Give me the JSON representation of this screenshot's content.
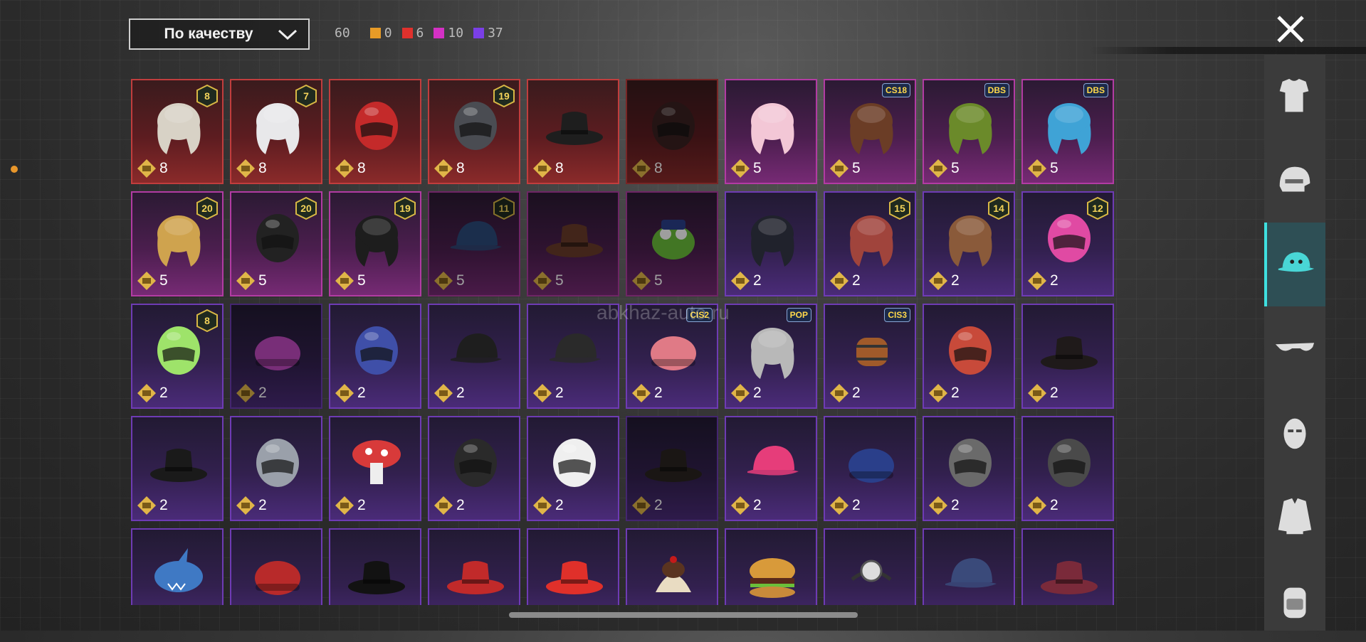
{
  "sort": {
    "label": "По качеству"
  },
  "counts": {
    "total": "60",
    "tiers": [
      {
        "color": "#e79b27",
        "count": "0"
      },
      {
        "color": "#e0312d",
        "count": "6"
      },
      {
        "color": "#d431c4",
        "count": "10"
      },
      {
        "color": "#7a3fe6",
        "count": "37"
      }
    ]
  },
  "watermark": "abkhaz-auto.ru",
  "items": [
    {
      "name": "white-hair-helmet",
      "quality": "red",
      "value": "8",
      "level": "8",
      "icon": "hair-white",
      "color": "#d8d2c6"
    },
    {
      "name": "white-long-hair",
      "quality": "red",
      "value": "8",
      "level": "7",
      "icon": "hair-long-white",
      "color": "#e8e8ea"
    },
    {
      "name": "red-helmet",
      "quality": "red",
      "value": "8",
      "icon": "helmet-red",
      "color": "#c42a2a"
    },
    {
      "name": "dark-visor-helmet",
      "quality": "red",
      "value": "8",
      "level": "19",
      "icon": "helmet-dark",
      "color": "#4a4c52"
    },
    {
      "name": "tricorn-hat",
      "quality": "red",
      "value": "8",
      "icon": "tricorn",
      "color": "#1e1e1e"
    },
    {
      "name": "orange-black-helmet",
      "quality": "red",
      "value": "8",
      "dim": true,
      "icon": "helmet-orange",
      "color": "#3a2020"
    },
    {
      "name": "pink-pigtails",
      "quality": "pink",
      "value": "5",
      "icon": "hair-pink",
      "color": "#f3c7d6"
    },
    {
      "name": "brown-short-hair",
      "quality": "pink",
      "value": "5",
      "tag": "CS18",
      "icon": "hair-brown",
      "color": "#6b3d26"
    },
    {
      "name": "dragon-ball-cap-hair",
      "quality": "pink",
      "value": "5",
      "tag": "DBS",
      "icon": "hair-green-cap",
      "color": "#6b8a2a"
    },
    {
      "name": "blue-spiky-hair",
      "quality": "pink",
      "value": "5",
      "tag": "DBS",
      "icon": "hair-blue",
      "color": "#3fa3d6"
    },
    {
      "name": "blonde-witch-hat",
      "quality": "pink",
      "value": "5",
      "level": "20",
      "icon": "hair-blonde",
      "color": "#cfa34e"
    },
    {
      "name": "gold-black-helmet",
      "quality": "pink",
      "value": "5",
      "level": "20",
      "icon": "helmet-gold",
      "color": "#222"
    },
    {
      "name": "black-bun-hair",
      "quality": "pink",
      "value": "5",
      "level": "19",
      "icon": "hair-black",
      "color": "#1d1d1d"
    },
    {
      "name": "blue-cap-hair",
      "quality": "pink",
      "value": "5",
      "level": "11",
      "dim": true,
      "icon": "cap-blue",
      "color": "#2b4a7a"
    },
    {
      "name": "cowboy-frog-hat",
      "quality": "pink",
      "value": "5",
      "dim": true,
      "icon": "cowboy",
      "color": "#6b3c2a"
    },
    {
      "name": "frog-police-hat",
      "quality": "pink",
      "value": "5",
      "dim": true,
      "icon": "frog",
      "color": "#6bbf3a"
    },
    {
      "name": "black-long-hair",
      "quality": "purple",
      "value": "2",
      "icon": "hair-black-long",
      "color": "#20222c"
    },
    {
      "name": "red-hair-pumpkin",
      "quality": "purple",
      "value": "2",
      "level": "15",
      "icon": "hair-red",
      "color": "#a0443c"
    },
    {
      "name": "cat-ear-hair",
      "quality": "purple",
      "value": "2",
      "level": "14",
      "icon": "hair-cat",
      "color": "#8a5a3a"
    },
    {
      "name": "bunny-ear-helmet",
      "quality": "purple",
      "value": "2",
      "level": "12",
      "icon": "helmet-bunny",
      "color": "#e04aa3"
    },
    {
      "name": "green-skull-hair",
      "quality": "purple",
      "value": "2",
      "level": "8",
      "icon": "skull-green",
      "color": "#9ee36a"
    },
    {
      "name": "pink-beanie",
      "quality": "purple",
      "value": "2",
      "dim": true,
      "icon": "beanie-pink",
      "color": "#c24ac2"
    },
    {
      "name": "robot-helmet",
      "quality": "purple",
      "value": "2",
      "icon": "helmet-robot",
      "color": "#3f4fa8"
    },
    {
      "name": "black-cap",
      "quality": "purple",
      "value": "2",
      "icon": "cap-black",
      "color": "#1e1e1e"
    },
    {
      "name": "mesh-cap",
      "quality": "purple",
      "value": "2",
      "icon": "cap-mesh",
      "color": "#2a2a2a"
    },
    {
      "name": "striped-beanie",
      "quality": "purple",
      "value": "2",
      "tag": "CIS2",
      "icon": "beanie-stripe",
      "color": "#e07a86"
    },
    {
      "name": "silver-short-hair",
      "quality": "purple",
      "value": "2",
      "tag": "POP",
      "icon": "hair-silver",
      "color": "#b8b8b8"
    },
    {
      "name": "barrel-hat",
      "quality": "purple",
      "value": "2",
      "tag": "CIS3",
      "icon": "barrel",
      "color": "#a05a2a"
    },
    {
      "name": "football-helmet",
      "quality": "purple",
      "value": "2",
      "icon": "helmet-football",
      "color": "#c84a3a"
    },
    {
      "name": "sombrero",
      "quality": "purple",
      "value": "2",
      "icon": "sombrero",
      "color": "#1f1a1a"
    },
    {
      "name": "pork-pie-hat",
      "quality": "purple",
      "value": "2",
      "icon": "hat-pork",
      "color": "#1a1a1a"
    },
    {
      "name": "goggles-helmet",
      "quality": "purple",
      "value": "2",
      "icon": "goggles",
      "color": "#9aa0aa"
    },
    {
      "name": "mushroom-hat",
      "quality": "purple",
      "value": "2",
      "icon": "mushroom",
      "color": "#d83a3a"
    },
    {
      "name": "moto-helmet",
      "quality": "purple",
      "value": "2",
      "icon": "helmet-moto",
      "color": "#2a2a2a"
    },
    {
      "name": "kabuki-mask",
      "quality": "purple",
      "value": "2",
      "icon": "kabuki",
      "color": "#efefef"
    },
    {
      "name": "steampunk-hat",
      "quality": "purple",
      "value": "2",
      "dim": true,
      "icon": "steampunk",
      "color": "#2a2420"
    },
    {
      "name": "pink-baseball-cap",
      "quality": "purple",
      "value": "2",
      "icon": "cap-pink",
      "color": "#e63d7a"
    },
    {
      "name": "blue-bird-beanie",
      "quality": "purple",
      "value": "2",
      "icon": "beanie-blue",
      "color": "#2a3f8a"
    },
    {
      "name": "army-helmet",
      "quality": "purple",
      "value": "2",
      "icon": "helmet-army",
      "color": "#6a6a6a"
    },
    {
      "name": "luchador-mask",
      "quality": "purple",
      "value": "2",
      "icon": "luchador",
      "color": "#4a4a4a"
    },
    {
      "name": "shark-hat",
      "quality": "purple",
      "icon": "shark",
      "color": "#3f79c4"
    },
    {
      "name": "red-beret",
      "quality": "purple",
      "icon": "beret",
      "color": "#b82a2a"
    },
    {
      "name": "black-top-hat",
      "quality": "purple",
      "icon": "tophat",
      "color": "#121212"
    },
    {
      "name": "red-fedora",
      "quality": "purple",
      "icon": "fedora",
      "color": "#c12a2a"
    },
    {
      "name": "red-bucket-hat",
      "quality": "purple",
      "icon": "bucket",
      "color": "#e0302a"
    },
    {
      "name": "sundae-hat",
      "quality": "purple",
      "icon": "sundae",
      "color": "#e9dcc2"
    },
    {
      "name": "burger-hat",
      "quality": "purple",
      "icon": "burger",
      "color": "#d89a3a"
    },
    {
      "name": "head-mirror",
      "quality": "purple",
      "icon": "headmirror",
      "color": "#cccccc"
    },
    {
      "name": "garrison-cap",
      "quality": "purple",
      "icon": "garrison",
      "color": "#3a4a7a"
    },
    {
      "name": "maroon-fedora",
      "quality": "purple",
      "icon": "fedora-maroon",
      "color": "#7a2a3a"
    }
  ],
  "right_tabs": [
    {
      "name": "tab-outfit",
      "icon": "outfit-icon",
      "active": false
    },
    {
      "name": "tab-helmet",
      "icon": "helmet-icon",
      "active": false
    },
    {
      "name": "tab-hat",
      "icon": "cap-icon",
      "active": true
    },
    {
      "name": "tab-glasses",
      "icon": "glasses-icon",
      "active": false
    },
    {
      "name": "tab-mask",
      "icon": "mask-icon",
      "active": false
    },
    {
      "name": "tab-jacket",
      "icon": "jacket-icon",
      "active": false
    },
    {
      "name": "tab-backpack",
      "icon": "backpack-icon",
      "active": false
    }
  ]
}
